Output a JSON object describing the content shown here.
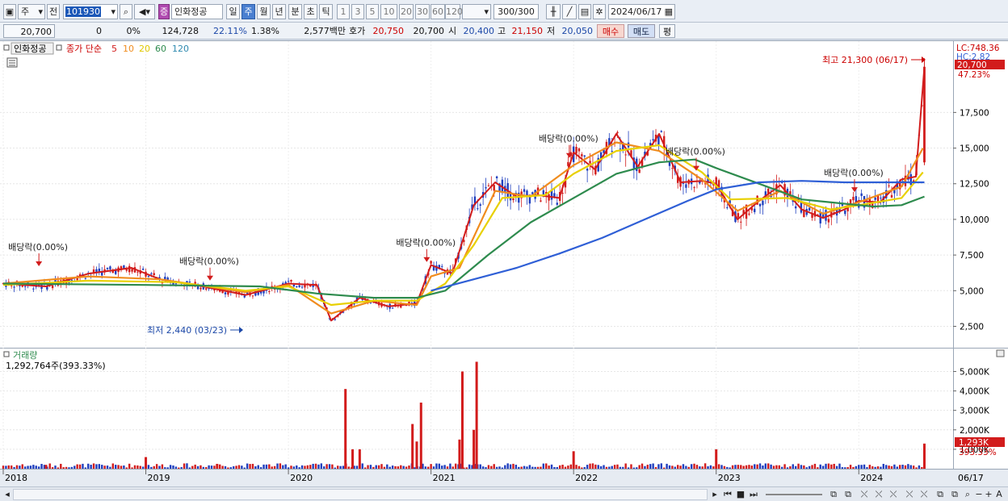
{
  "toolbar": {
    "period_select": "주",
    "prev_label": "전",
    "code": "101930",
    "stock_name": "인화정공",
    "stock_badge": "증",
    "period_tabs": [
      "일",
      "주",
      "월",
      "년",
      "분",
      "초",
      "틱"
    ],
    "active_tab": "주",
    "multipliers": [
      "1",
      "3",
      "5",
      "10",
      "20",
      "30",
      "60",
      "120"
    ],
    "count_value": "300/300",
    "date_value": "2024/06/17"
  },
  "info": {
    "price": "20,700",
    "change": "0",
    "change_pct": "0%",
    "volume": "124,728",
    "vol_ratio": "22.11%",
    "turnover": "1.38%",
    "amount": "2,577백만",
    "quote_label": "호가",
    "quote_ask": "20,750",
    "quote_bid": "20,700",
    "open_label": "시",
    "open": "20,400",
    "high_label": "고",
    "high": "21,150",
    "low_label": "저",
    "low": "20,050",
    "buy_label": "매수",
    "sell_label": "매도",
    "eval_label": "평"
  },
  "legend": {
    "stock": "인화정공",
    "type": "종가 단순",
    "ma": [
      {
        "label": "5",
        "color": "#d21c1c"
      },
      {
        "label": "10",
        "color": "#f08c1e"
      },
      {
        "label": "20",
        "color": "#e8d000"
      },
      {
        "label": "60",
        "color": "#2e8b4e"
      },
      {
        "label": "120",
        "color": "#2f5fd6"
      }
    ]
  },
  "price_axis": [
    "17,500",
    "15,000",
    "12,500",
    "10,000",
    "7,500",
    "5,000",
    "2,500"
  ],
  "right_labels": {
    "lc": "LC:748.36",
    "hc": "HC:2.82",
    "price_box": "20,700",
    "pct": "47.23%"
  },
  "annotations": {
    "high": "최고 21,300 (06/17)",
    "low": "최저 2,440 (03/23)",
    "dividend": "배당락(0.00%)"
  },
  "volume": {
    "title": "거래량",
    "value": "1,292,764주(393.33%)",
    "axis": [
      "5,000K",
      "4,000K",
      "3,000K",
      "2,000K",
      "1,000K"
    ],
    "box": "1,293K",
    "pct": "393.33%"
  },
  "time_axis": [
    "2018",
    "2019",
    "2020",
    "2021",
    "2022",
    "2023",
    "2024"
  ],
  "time_axis_end": "06/17",
  "chart_data": {
    "type": "line",
    "title": "",
    "ylim": [
      1000,
      22500
    ],
    "series": [
      {
        "name": "5",
        "x": [
          2018.0,
          2018.3,
          2018.6,
          2018.9,
          2019.1,
          2019.4,
          2019.7,
          2020.0,
          2020.2,
          2020.3,
          2020.5,
          2020.7,
          2020.9,
          2021.0,
          2021.15,
          2021.3,
          2021.45,
          2021.6,
          2021.75,
          2021.9,
          2022.0,
          2022.15,
          2022.3,
          2022.45,
          2022.6,
          2022.75,
          2022.9,
          2023.0,
          2023.15,
          2023.3,
          2023.45,
          2023.6,
          2023.75,
          2023.9,
          2024.0,
          2024.15,
          2024.3,
          2024.4,
          2024.46
        ],
        "values": [
          5500,
          5300,
          6200,
          6600,
          5800,
          5300,
          4700,
          5500,
          5400,
          2900,
          4500,
          3900,
          4100,
          6800,
          6200,
          11000,
          12600,
          11600,
          11700,
          11500,
          14700,
          13500,
          16000,
          13700,
          16000,
          12600,
          12700,
          12500,
          10000,
          11300,
          12400,
          10700,
          10100,
          10700,
          11300,
          11200,
          12800,
          13000,
          20700
        ]
      },
      {
        "name": "10",
        "x": [
          2018.0,
          2018.6,
          2019.1,
          2019.7,
          2020.0,
          2020.3,
          2020.6,
          2020.9,
          2021.0,
          2021.2,
          2021.45,
          2021.7,
          2022.0,
          2022.3,
          2022.6,
          2022.9,
          2023.15,
          2023.45,
          2023.75,
          2024.0,
          2024.3,
          2024.45
        ],
        "values": [
          5500,
          6000,
          5800,
          4900,
          5400,
          3400,
          4300,
          4000,
          6000,
          6600,
          12000,
          11600,
          13800,
          15400,
          14800,
          12800,
          10600,
          12000,
          10400,
          11200,
          12300,
          15000
        ]
      },
      {
        "name": "20",
        "x": [
          2018.0,
          2018.6,
          2019.2,
          2019.7,
          2020.0,
          2020.3,
          2020.6,
          2020.9,
          2021.1,
          2021.3,
          2021.5,
          2021.8,
          2022.0,
          2022.3,
          2022.6,
          2022.9,
          2023.1,
          2023.5,
          2023.8,
          2024.0,
          2024.3,
          2024.45
        ],
        "values": [
          5400,
          5700,
          5600,
          5000,
          5300,
          4000,
          4300,
          4300,
          5500,
          8200,
          11500,
          11700,
          13200,
          14800,
          15200,
          13300,
          11400,
          11500,
          10700,
          11000,
          11500,
          13300
        ]
      },
      {
        "name": "60",
        "x": [
          2018.0,
          2019.0,
          2019.8,
          2020.2,
          2020.6,
          2020.9,
          2021.1,
          2021.4,
          2021.7,
          2022.0,
          2022.3,
          2022.6,
          2022.85,
          2023.0,
          2023.3,
          2023.6,
          2023.9,
          2024.1,
          2024.3,
          2024.46
        ],
        "values": [
          5500,
          5400,
          5300,
          4800,
          4500,
          4500,
          5000,
          7500,
          9800,
          11500,
          13200,
          14000,
          14200,
          13600,
          12500,
          11400,
          11100,
          10900,
          11000,
          11600
        ]
      },
      {
        "name": "120",
        "x": [
          2021.0,
          2021.3,
          2021.6,
          2021.9,
          2022.2,
          2022.5,
          2022.8,
          2023.0,
          2023.3,
          2023.6,
          2023.9,
          2024.2,
          2024.46
        ],
        "values": [
          5000,
          5800,
          6600,
          7600,
          8700,
          10000,
          11300,
          12100,
          12600,
          12700,
          12600,
          12600,
          12600
        ]
      }
    ],
    "volume_series": {
      "name": "거래량",
      "x": [
        2018.3,
        2019.0,
        2019.5,
        2020.4,
        2020.45,
        2020.5,
        2020.87,
        2020.9,
        2020.93,
        2021.2,
        2021.22,
        2021.3,
        2021.32,
        2022.0,
        2023.0,
        2024.46
      ],
      "values": [
        200,
        600,
        250,
        4100,
        1000,
        1000,
        2300,
        1400,
        3400,
        1500,
        5000,
        2000,
        5500,
        900,
        1000,
        1293
      ]
    }
  }
}
